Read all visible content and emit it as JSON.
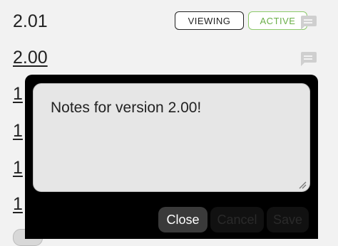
{
  "versions": [
    {
      "label": "2.01",
      "viewing_badge": "VIEWING",
      "active_badge": "ACTIVE"
    },
    {
      "label": "2.00"
    },
    {
      "label": "1"
    },
    {
      "label": "1"
    },
    {
      "label": "1"
    },
    {
      "label": "1"
    }
  ],
  "notes_dialog": {
    "text": "Notes for version 2.00!",
    "close_label": "Close",
    "cancel_label": "Cancel",
    "save_label": "Save"
  },
  "colors": {
    "active": "#6aaf48",
    "dialog_bg": "#000000"
  },
  "icons": {
    "notes": "comment-icon",
    "resize": "resize-grip-icon"
  }
}
